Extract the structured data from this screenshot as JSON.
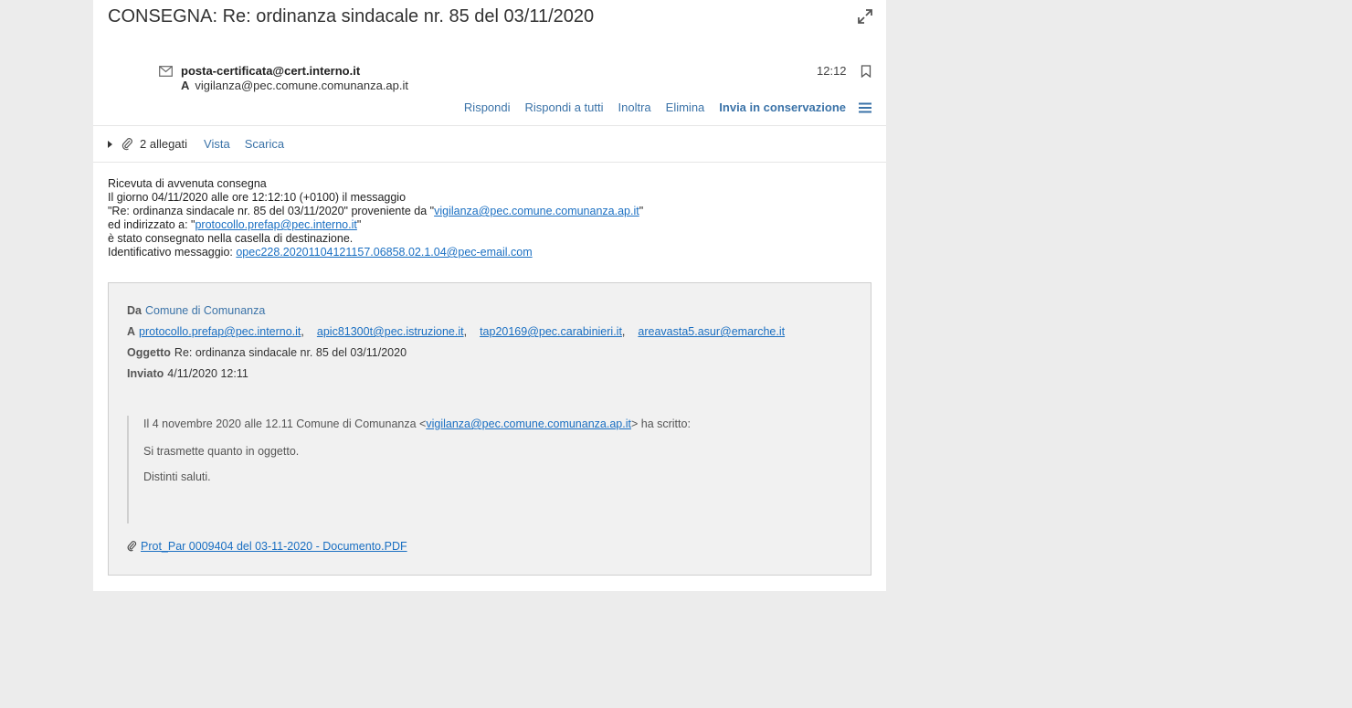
{
  "message": {
    "subject": "CONSEGNA: Re: ordinanza sindacale nr. 85 del 03/11/2020",
    "from": "posta-certificata@cert.interno.it",
    "to_label": "A",
    "to": "vigilanza@pec.comune.comunanza.ap.it",
    "time": "12:12"
  },
  "actions": {
    "reply": "Rispondi",
    "reply_all": "Rispondi a tutti",
    "forward": "Inoltra",
    "delete": "Elimina",
    "archive": "Invia in conservazione"
  },
  "attachments": {
    "count_label": "2 allegati",
    "view": "Vista",
    "download": "Scarica"
  },
  "receipt": {
    "line1": "Ricevuta di avvenuta consegna",
    "line2": "Il giorno 04/11/2020 alle ore 12:12:10 (+0100) il messaggio",
    "line3_prefix": "\"Re: ordinanza sindacale nr. 85 del 03/11/2020\" proveniente da \"",
    "line3_link": "vigilanza@pec.comune.comunanza.ap.it",
    "line3_suffix": "\"",
    "line4_prefix": "ed indirizzato a: \"",
    "line4_link": "protocollo.prefap@pec.interno.it",
    "line4_suffix": "\"",
    "line5": "è stato consegnato nella casella di destinazione.",
    "line6_prefix": "Identificativo messaggio: ",
    "line6_link": "opec228.20201104121157.06858.02.1.04@pec-email.com"
  },
  "original": {
    "from_label": "Da",
    "from_name": "Comune di Comunanza",
    "to_label": "A",
    "recipients": [
      "protocollo.prefap@pec.interno.it",
      "apic81300t@pec.istruzione.it",
      "tap20169@pec.carabinieri.it",
      "areavasta5.asur@emarche.it"
    ],
    "subject_label": "Oggetto",
    "subject": "Re: ordinanza sindacale nr. 85 del 03/11/2020",
    "sent_label": "Inviato",
    "sent": "4/11/2020 12:11",
    "quote_intro_prefix": "Il 4 novembre 2020 alle 12.11 Comune di Comunanza <",
    "quote_intro_link": "vigilanza@pec.comune.comunanza.ap.it",
    "quote_intro_suffix": "> ha scritto:",
    "quote_line1": "Si trasmette quanto in oggetto.",
    "quote_line2": "Distinti saluti.",
    "attachment": "Prot_Par 0009404 del 03-11-2020 - Documento.PDF"
  }
}
